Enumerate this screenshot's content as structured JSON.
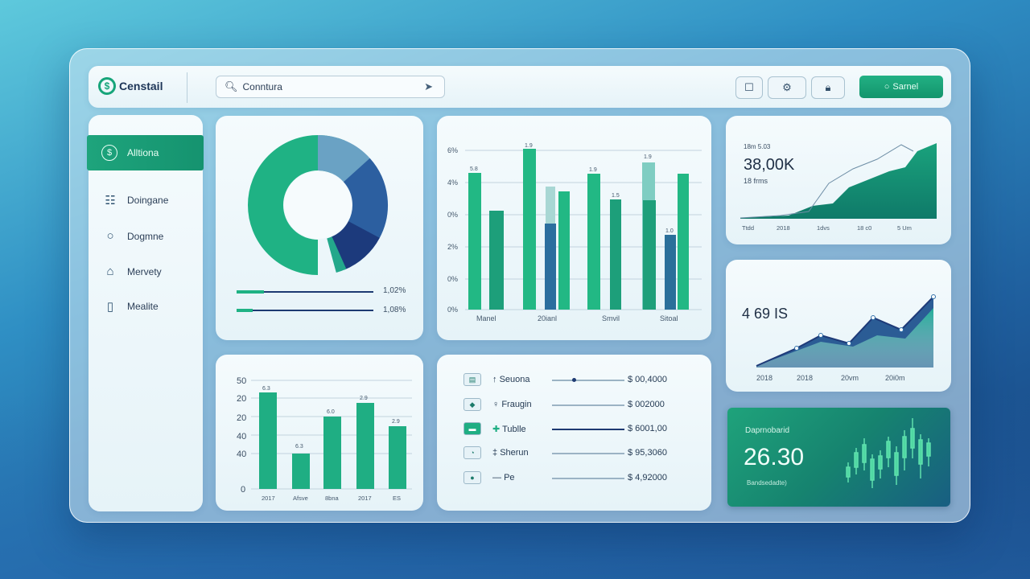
{
  "header": {
    "brand": "Censtail",
    "search_value": "Conntura",
    "primary_button": "Sarnel"
  },
  "sidebar": {
    "items": [
      {
        "label": "Alltiona",
        "icon": "dollar-circle-icon",
        "active": true
      },
      {
        "label": "Doingane",
        "icon": "people-icon"
      },
      {
        "label": "Dogmne",
        "icon": "circle-icon"
      },
      {
        "label": "Mervety",
        "icon": "house-icon"
      },
      {
        "label": "Mealite",
        "icon": "document-icon"
      }
    ]
  },
  "donut_card": {
    "progress": [
      {
        "label": "1,02%",
        "fill": 0.2
      },
      {
        "label": "1,08%",
        "fill": 0.12
      }
    ]
  },
  "bar_chart_top": {
    "y_ticks": [
      "6%",
      "4%",
      "0%",
      "2%",
      "0%",
      "0%"
    ],
    "x_labels": [
      "Manel",
      "20ianl",
      "Smvil",
      "Sitoal"
    ],
    "data_labels": [
      "5.8",
      "1.9",
      "1.9",
      "1.5",
      "1.9",
      "1.0"
    ]
  },
  "area_card_top": {
    "caption": "18m 5.03",
    "value": "38,00K",
    "sub": "18 frms",
    "x_labels": [
      "Ttdd",
      "2018",
      "1dvs",
      "18 c0",
      "5 Um"
    ]
  },
  "line_card": {
    "value": "4 69 IS",
    "x_labels": [
      "2018",
      "2018",
      "20vm",
      "20i0m"
    ]
  },
  "green_card": {
    "caption": "Daprnobarid",
    "value": "26.30",
    "sub": "Bandsedadte)"
  },
  "bar_chart_bottom": {
    "y_ticks": [
      "50",
      "20",
      "20",
      "40",
      "40",
      "0"
    ],
    "x_labels": [
      "2017",
      "Afsve",
      "8bna",
      "2017",
      "ES"
    ],
    "data_labels": [
      "6.3",
      "6.3",
      "6.0",
      "2.9",
      "2.9"
    ]
  },
  "transactions": [
    {
      "label": "Seuona",
      "value": "$ 00,4000",
      "icon": "wallet-icon",
      "slider": 0.28
    },
    {
      "label": "Fraugin",
      "value": "$ 002000",
      "icon": "chat-icon",
      "slider": 0
    },
    {
      "label": "Tublle",
      "value": "$ 6001,00",
      "icon": "card-icon",
      "slider": 1
    },
    {
      "label": "Sherun",
      "value": "$ 95,3060",
      "icon": "signal-icon",
      "slider": 0
    },
    {
      "label": "Pe",
      "value": "$ 4,92000",
      "icon": "globe-icon",
      "slider": 0
    }
  ],
  "colors": {
    "accent_green": "#17a57a",
    "navy": "#1e3a78",
    "blue": "#2e6fa8"
  }
}
